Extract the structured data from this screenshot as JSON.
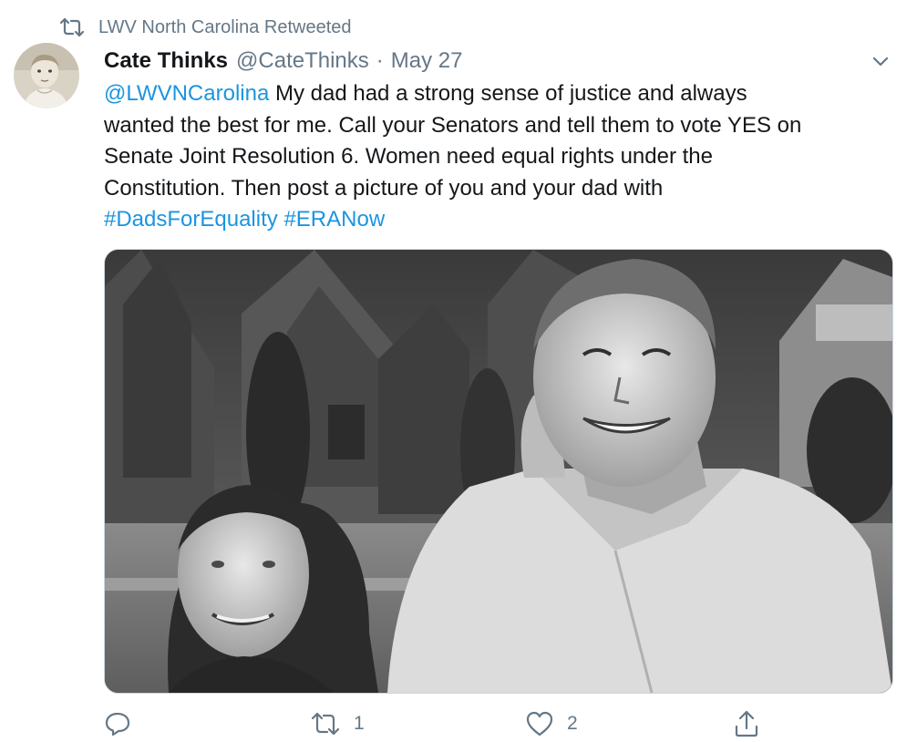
{
  "retweet_context": {
    "text": "LWV North Carolina Retweeted",
    "icon": "retweet-icon"
  },
  "tweet": {
    "author_name": "Cate Thinks",
    "author_handle": "@CateThinks",
    "separator": "·",
    "date": "May 27",
    "text": {
      "mention": "@LWVNCarolina",
      "line1_rest": " My dad had a strong sense of justice and always",
      "line2": "wanted the best for me.  Call your Senators and tell them to vote YES on",
      "line3": "Senate Joint Resolution 6. Women need equal rights under the",
      "line4": "Constitution. Then post a picture of you and your dad with",
      "hashtag1": "#DadsForEquality",
      "hashtag2": "#ERANow"
    }
  },
  "actions": {
    "reply": {
      "icon": "reply-icon",
      "count": ""
    },
    "retweet": {
      "icon": "retweet-icon",
      "count": "1"
    },
    "like": {
      "icon": "heart-icon",
      "count": "2"
    },
    "share": {
      "icon": "share-icon",
      "count": ""
    }
  },
  "colors": {
    "link": "#1b95e0",
    "secondary_text": "#657786",
    "primary_text": "#14171a",
    "border": "#ccd6dd"
  }
}
